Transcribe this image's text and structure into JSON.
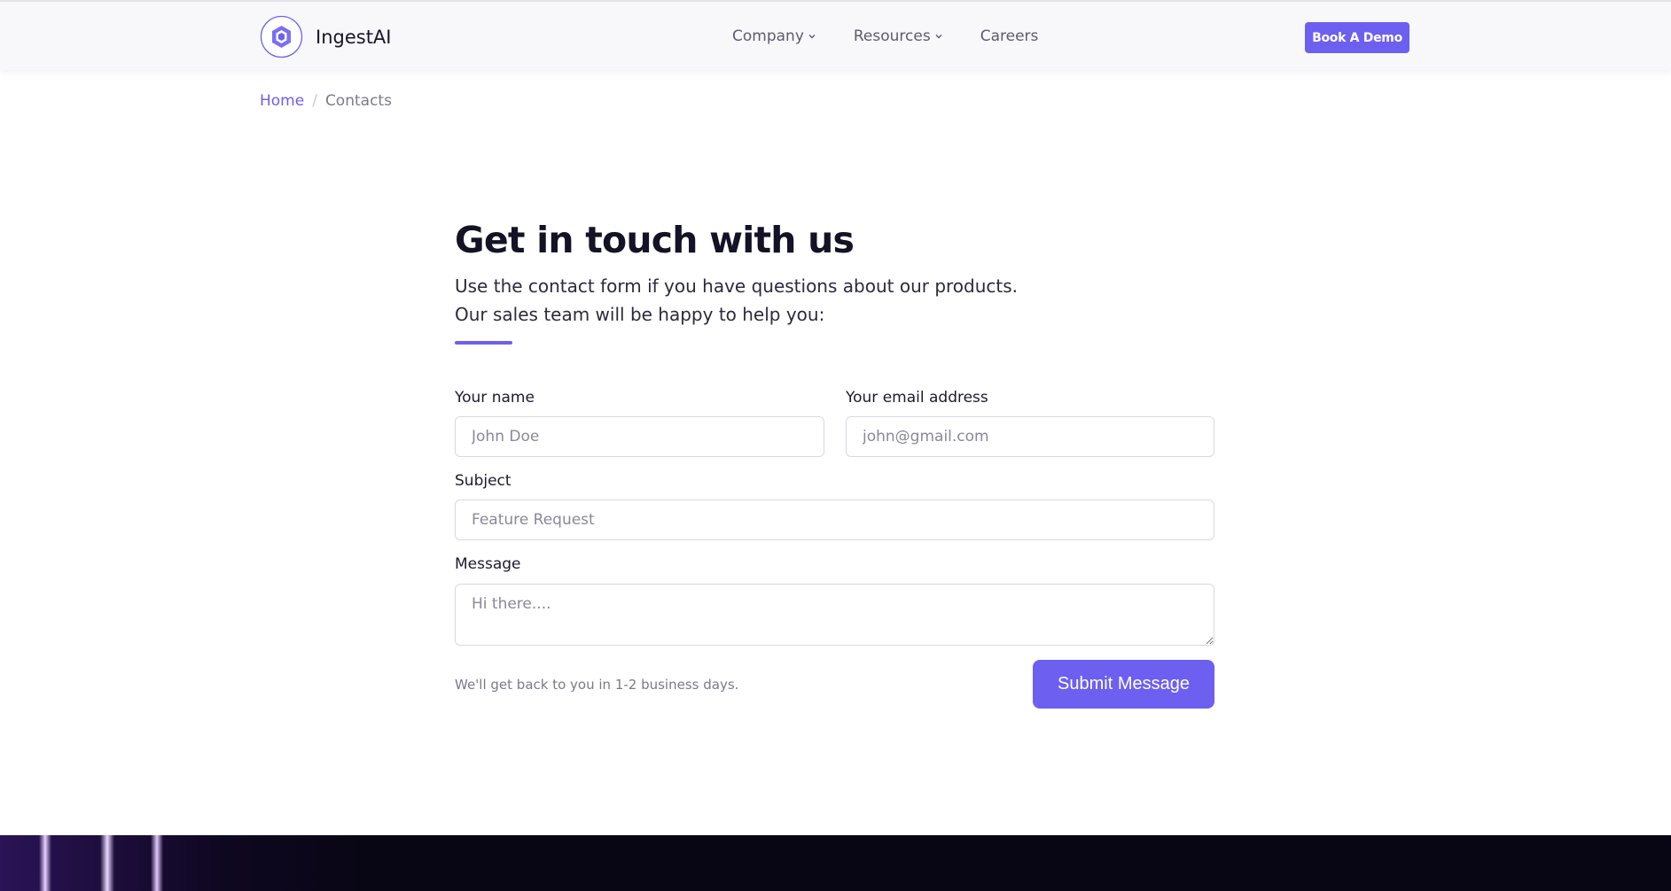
{
  "brand": {
    "name": "IngestAI",
    "logo_icon": "hexagon-logo-icon",
    "accent_color": "#6d5ff0"
  },
  "nav": {
    "items": [
      {
        "label": "Company",
        "icon": "chevron-down-icon"
      },
      {
        "label": "Resources",
        "icon": "chevron-down-icon"
      },
      {
        "label": "Careers"
      }
    ],
    "cta_label": "Book A Demo"
  },
  "breadcrumb": {
    "home": "Home",
    "separator": "/",
    "current": "Contacts"
  },
  "hero": {
    "title": "Get in touch with us",
    "line1": "Use the contact form if you have questions about our products.",
    "line2": "Our sales team will be happy to help you:"
  },
  "form": {
    "name": {
      "label": "Your name",
      "placeholder": "John Doe",
      "value": ""
    },
    "email": {
      "label": "Your email address",
      "placeholder": "john@gmail.com",
      "value": ""
    },
    "subject": {
      "label": "Subject",
      "placeholder": "Feature Request",
      "value": ""
    },
    "message": {
      "label": "Message",
      "placeholder": "Hi there....",
      "value": ""
    },
    "note": "We'll get back to you in 1-2 business days.",
    "submit_label": "Submit Message"
  }
}
